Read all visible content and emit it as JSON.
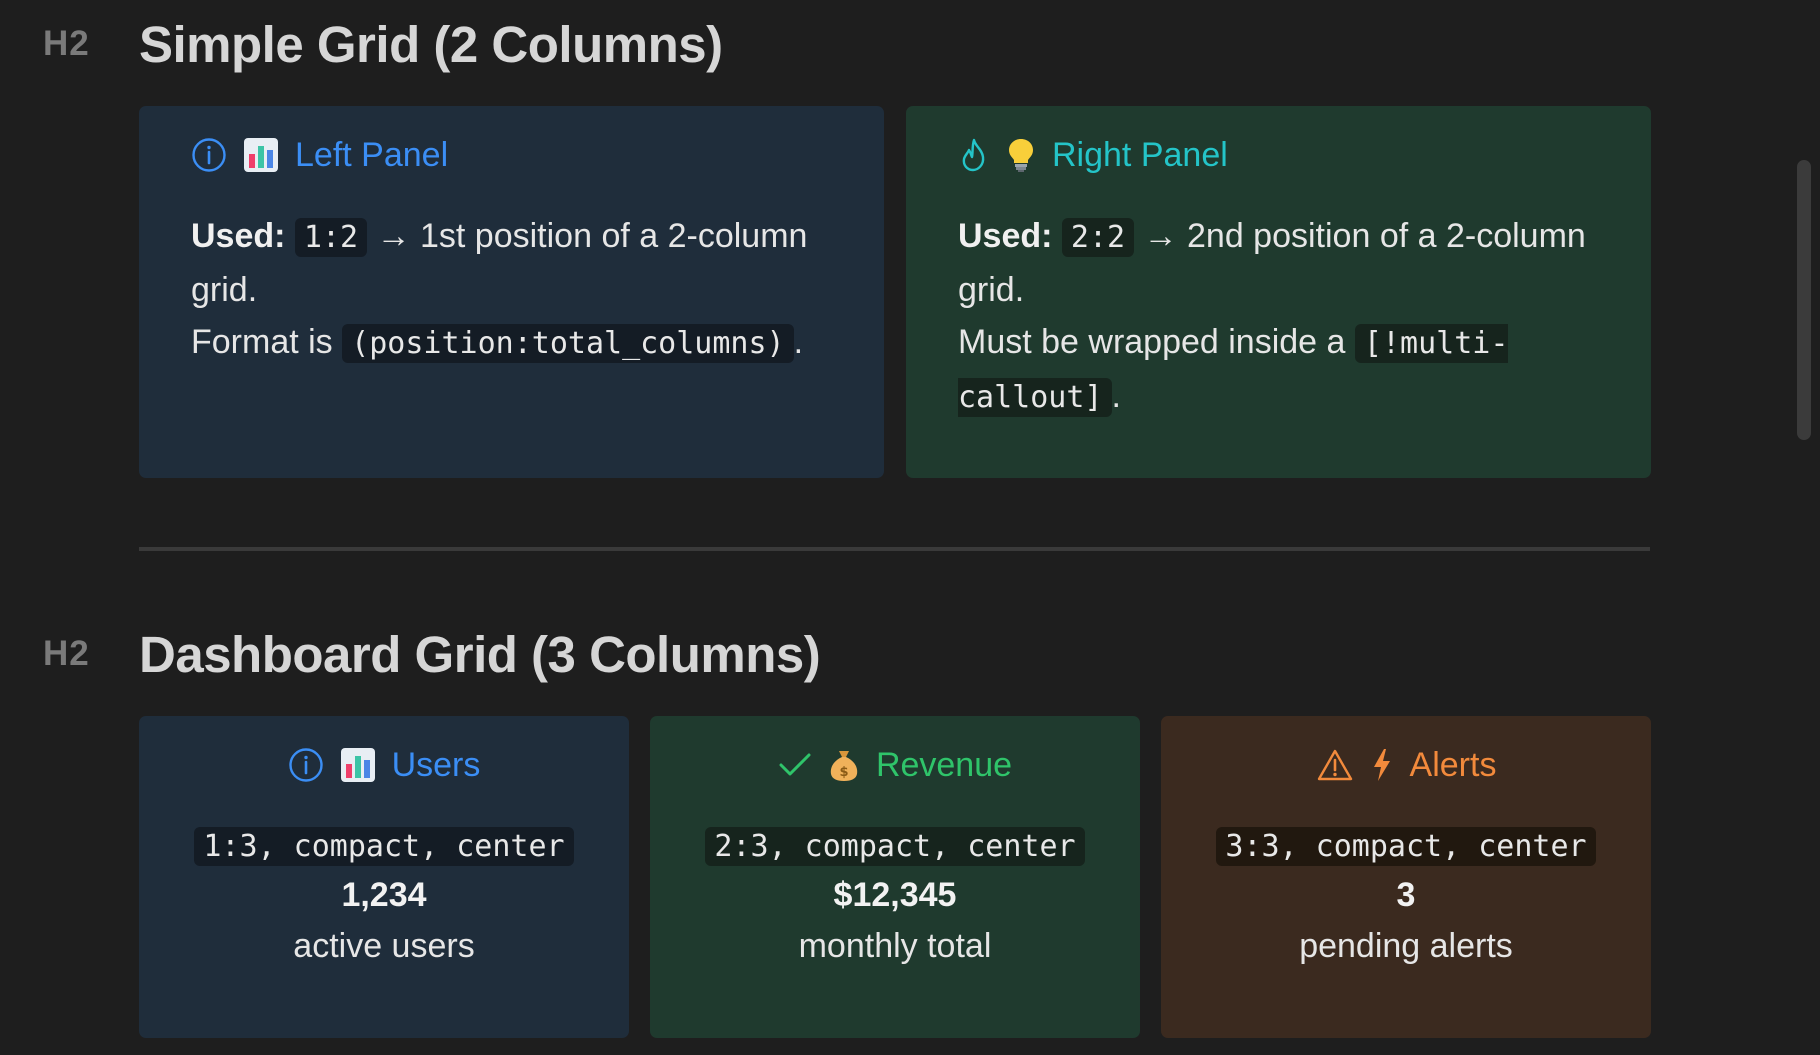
{
  "section1": {
    "level": "H2",
    "title": "Simple Grid (2 Columns)",
    "left_panel": {
      "title": "Left Panel",
      "used_label": "Used:",
      "used_code": "1:2",
      "used_text": "→ 1st position of a 2-column grid.",
      "format_text": "Format is",
      "format_code": "(position:total_columns)",
      "format_end": "."
    },
    "right_panel": {
      "title": "Right Panel",
      "used_label": "Used:",
      "used_code": "2:2",
      "used_text": "→ 2nd position of a 2-column grid.",
      "wrap_text": "Must be wrapped inside a",
      "wrap_code": "[!multi-callout]",
      "wrap_end": "."
    }
  },
  "section2": {
    "level": "H2",
    "title": "Dashboard Grid (3 Columns)",
    "cards": [
      {
        "title": "Users",
        "code": "1:3, compact, center",
        "value": "1,234",
        "label": "active users"
      },
      {
        "title": "Revenue",
        "code": "2:3, compact, center",
        "value": "$12,345",
        "label": "monthly total"
      },
      {
        "title": "Alerts",
        "code": "3:3, compact, center",
        "value": "3",
        "label": "pending alerts"
      }
    ]
  },
  "icons": {
    "left_panel": [
      "info-icon",
      "bar-chart-emoji"
    ],
    "right_panel": [
      "flame-icon",
      "lightbulb-emoji"
    ],
    "users": [
      "info-icon",
      "bar-chart-emoji"
    ],
    "revenue": [
      "check-icon",
      "money-bag-emoji"
    ],
    "alerts": [
      "warning-icon",
      "lightning-icon"
    ]
  },
  "colors": {
    "background": "#1e1e1e",
    "blue_callout": "#1f2d3b",
    "green_callout": "#1f3a2e",
    "orange_callout": "#3b2a1f",
    "blue_accent": "#3b8ef5",
    "teal_accent": "#24c4c8",
    "green_accent": "#2fc46a",
    "orange_accent": "#f28a3c"
  }
}
